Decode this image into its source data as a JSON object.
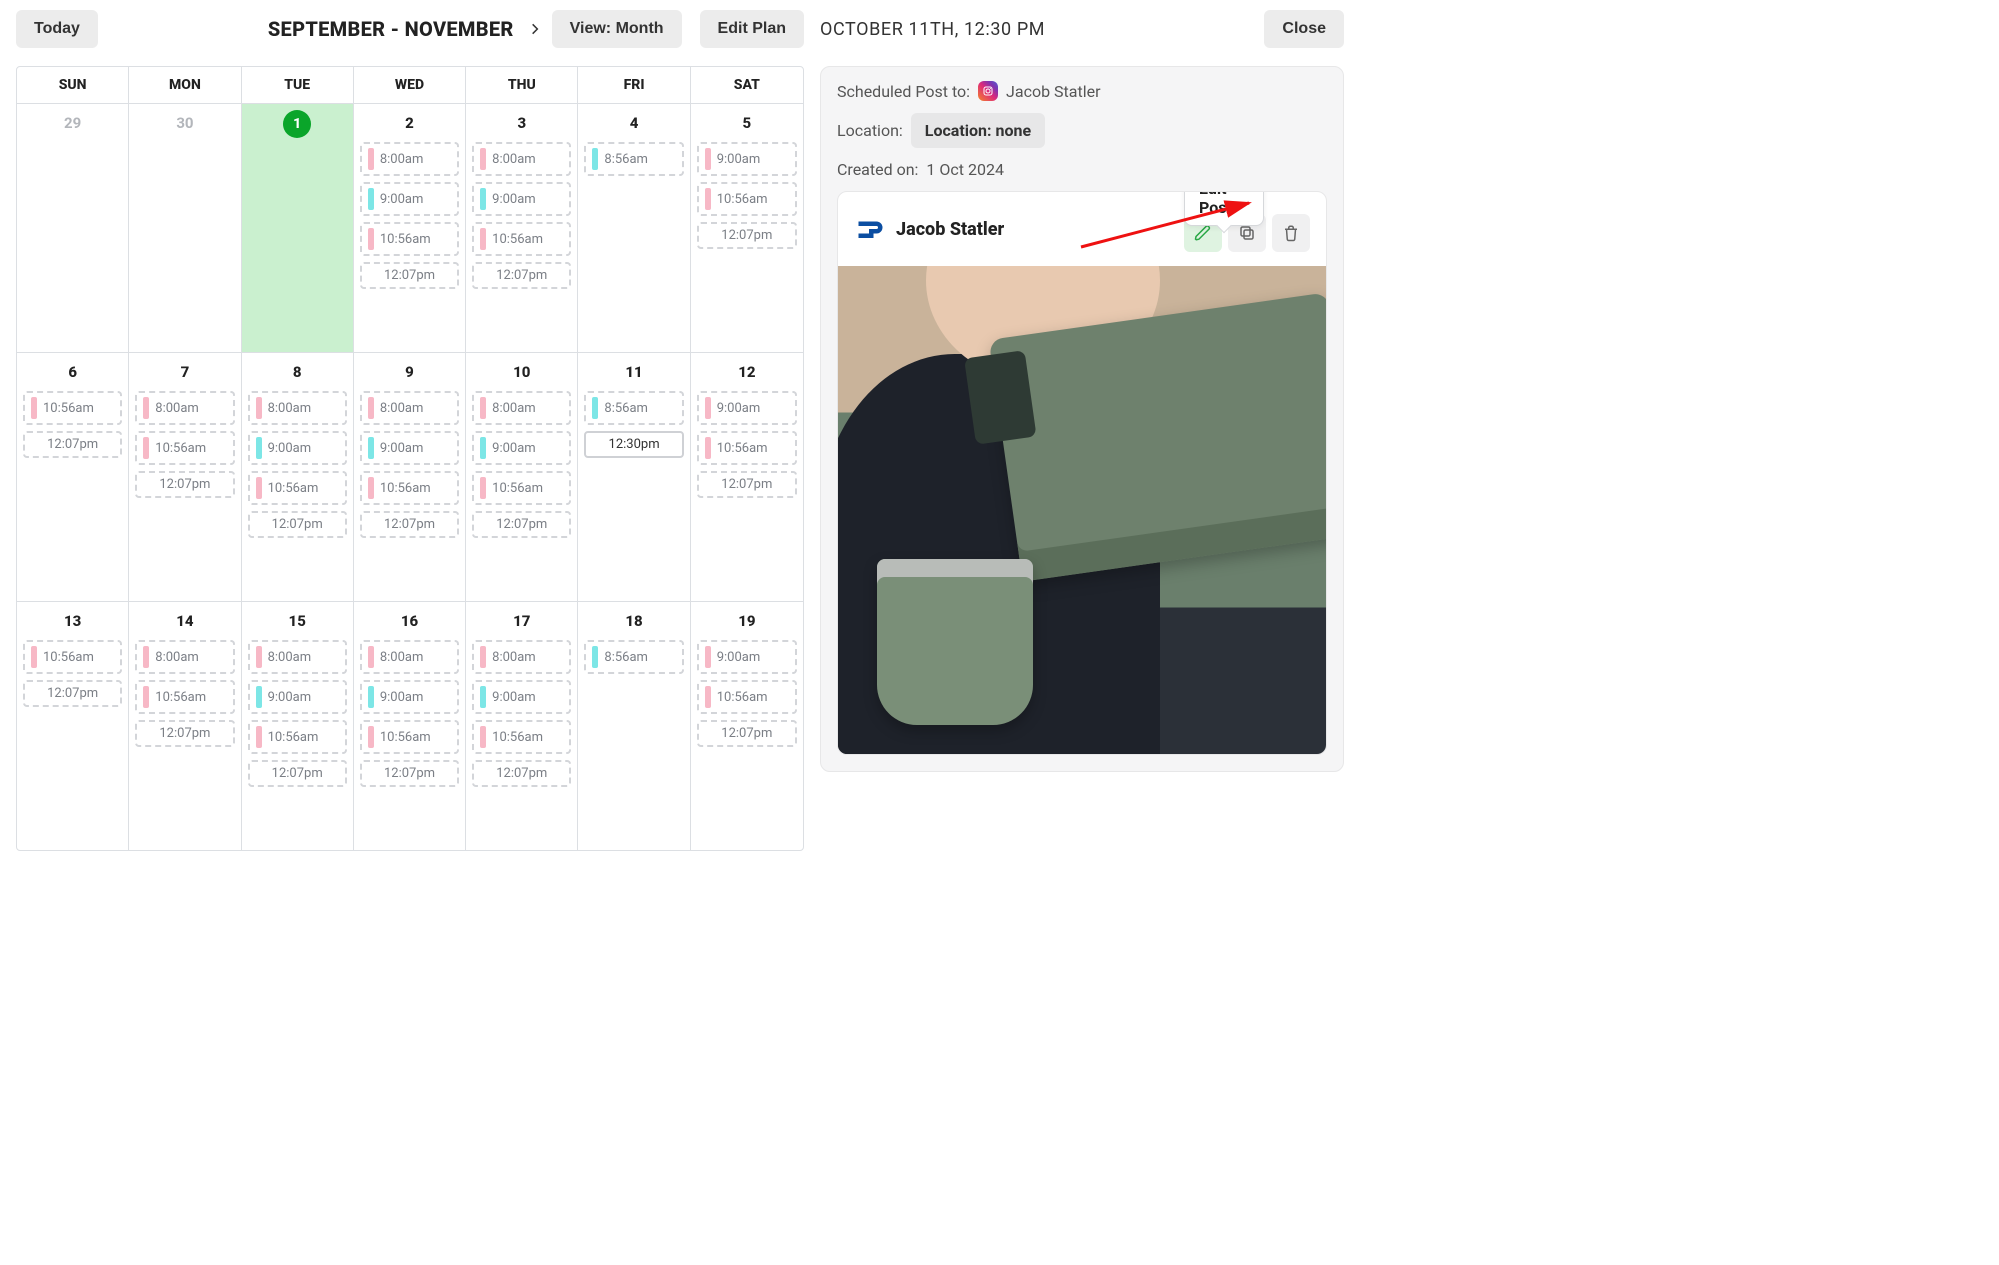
{
  "header": {
    "today_label": "Today",
    "range_label": "SEPTEMBER - NOVEMBER",
    "view_label": "View: Month",
    "edit_plan_label": "Edit Plan"
  },
  "sidebar_header": {
    "timestamp": "OCTOBER 11TH, 12:30 PM",
    "close_label": "Close"
  },
  "dow": [
    "SUN",
    "MON",
    "TUE",
    "WED",
    "THU",
    "FRI",
    "SAT"
  ],
  "weeks": [
    {
      "days": [
        {
          "date": "29",
          "muted": true,
          "slots": []
        },
        {
          "date": "30",
          "muted": true,
          "slots": []
        },
        {
          "date": "1",
          "today": true,
          "highlight": true,
          "slots": []
        },
        {
          "date": "2",
          "slots": [
            {
              "t": "8:00am",
              "c": "pink"
            },
            {
              "t": "9:00am",
              "c": "cyan"
            },
            {
              "t": "10:56am",
              "c": "pink"
            },
            {
              "t": "12:07pm",
              "c": "none"
            }
          ]
        },
        {
          "date": "3",
          "slots": [
            {
              "t": "8:00am",
              "c": "pink"
            },
            {
              "t": "9:00am",
              "c": "cyan"
            },
            {
              "t": "10:56am",
              "c": "pink"
            },
            {
              "t": "12:07pm",
              "c": "none"
            }
          ]
        },
        {
          "date": "4",
          "slots": [
            {
              "t": "8:56am",
              "c": "cyan"
            }
          ]
        },
        {
          "date": "5",
          "slots": [
            {
              "t": "9:00am",
              "c": "pink"
            },
            {
              "t": "10:56am",
              "c": "pink"
            },
            {
              "t": "12:07pm",
              "c": "none"
            }
          ]
        }
      ],
      "tall": true
    },
    {
      "days": [
        {
          "date": "6",
          "slots": [
            {
              "t": "10:56am",
              "c": "pink"
            },
            {
              "t": "12:07pm",
              "c": "none"
            }
          ]
        },
        {
          "date": "7",
          "slots": [
            {
              "t": "8:00am",
              "c": "pink"
            },
            {
              "t": "10:56am",
              "c": "pink"
            },
            {
              "t": "12:07pm",
              "c": "none"
            }
          ]
        },
        {
          "date": "8",
          "slots": [
            {
              "t": "8:00am",
              "c": "pink"
            },
            {
              "t": "9:00am",
              "c": "cyan"
            },
            {
              "t": "10:56am",
              "c": "pink"
            },
            {
              "t": "12:07pm",
              "c": "none"
            }
          ]
        },
        {
          "date": "9",
          "slots": [
            {
              "t": "8:00am",
              "c": "pink"
            },
            {
              "t": "9:00am",
              "c": "cyan"
            },
            {
              "t": "10:56am",
              "c": "pink"
            },
            {
              "t": "12:07pm",
              "c": "none"
            }
          ]
        },
        {
          "date": "10",
          "slots": [
            {
              "t": "8:00am",
              "c": "pink"
            },
            {
              "t": "9:00am",
              "c": "cyan"
            },
            {
              "t": "10:56am",
              "c": "pink"
            },
            {
              "t": "12:07pm",
              "c": "none"
            }
          ]
        },
        {
          "date": "11",
          "slots": [
            {
              "t": "8:56am",
              "c": "cyan"
            },
            {
              "t": "12:30pm",
              "c": "none",
              "solid": true
            }
          ]
        },
        {
          "date": "12",
          "slots": [
            {
              "t": "9:00am",
              "c": "pink"
            },
            {
              "t": "10:56am",
              "c": "pink"
            },
            {
              "t": "12:07pm",
              "c": "none"
            }
          ]
        }
      ],
      "tall": true
    },
    {
      "days": [
        {
          "date": "13",
          "slots": [
            {
              "t": "10:56am",
              "c": "pink"
            },
            {
              "t": "12:07pm",
              "c": "none"
            }
          ]
        },
        {
          "date": "14",
          "slots": [
            {
              "t": "8:00am",
              "c": "pink"
            },
            {
              "t": "10:56am",
              "c": "pink"
            },
            {
              "t": "12:07pm",
              "c": "none"
            }
          ]
        },
        {
          "date": "15",
          "slots": [
            {
              "t": "8:00am",
              "c": "pink"
            },
            {
              "t": "9:00am",
              "c": "cyan"
            },
            {
              "t": "10:56am",
              "c": "pink"
            },
            {
              "t": "12:07pm",
              "c": "none"
            }
          ]
        },
        {
          "date": "16",
          "slots": [
            {
              "t": "8:00am",
              "c": "pink"
            },
            {
              "t": "9:00am",
              "c": "cyan"
            },
            {
              "t": "10:56am",
              "c": "pink"
            },
            {
              "t": "12:07pm",
              "c": "none"
            }
          ]
        },
        {
          "date": "17",
          "slots": [
            {
              "t": "8:00am",
              "c": "pink"
            },
            {
              "t": "9:00am",
              "c": "cyan"
            },
            {
              "t": "10:56am",
              "c": "pink"
            },
            {
              "t": "12:07pm",
              "c": "none"
            }
          ]
        },
        {
          "date": "18",
          "slots": [
            {
              "t": "8:56am",
              "c": "cyan"
            }
          ]
        },
        {
          "date": "19",
          "slots": [
            {
              "t": "9:00am",
              "c": "pink"
            },
            {
              "t": "10:56am",
              "c": "pink"
            },
            {
              "t": "12:07pm",
              "c": "none"
            }
          ]
        }
      ],
      "tall": true
    }
  ],
  "detail": {
    "scheduled_label": "Scheduled Post to:",
    "account_name": "Jacob Statler",
    "location_label": "Location:",
    "location_value": "Location: none",
    "created_label": "Created on:",
    "created_value": "1 Oct 2024",
    "tooltip": "Edit Post",
    "profile_name": "Jacob Statler"
  },
  "icons": {
    "chevron": "chevron-right-icon",
    "pencil": "pencil-icon",
    "copy": "copy-icon",
    "trash": "trash-icon"
  }
}
